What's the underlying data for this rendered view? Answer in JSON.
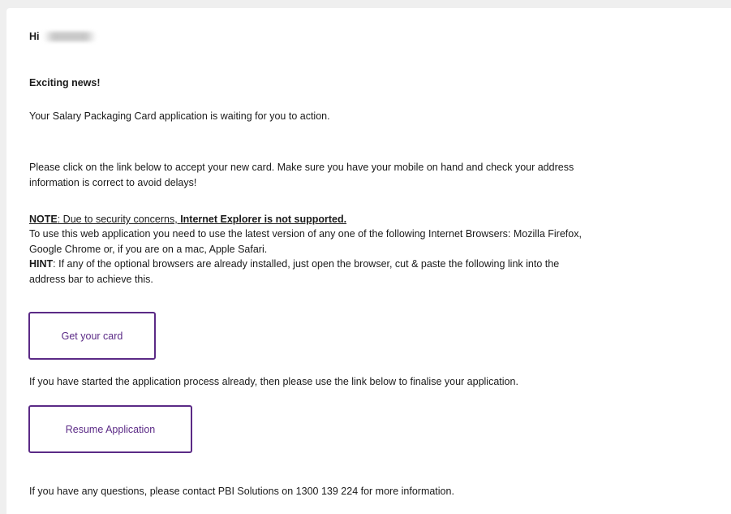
{
  "email": {
    "greeting": "Hi",
    "headline": "Exciting news!",
    "intro": "Your Salary Packaging Card application is waiting for you to action.",
    "instructions": [
      "Please click on the link below to accept your new card. Make sure you have your mobile on hand and check your address",
      "information is correct to avoid delays!"
    ],
    "note": {
      "label": "NOTE",
      "text": ": Due to security concerns, ",
      "emphasis": "Internet Explorer is not supported."
    },
    "browser_requirements": [
      "To use this web application you need to use the latest version of any one of the following Internet Browsers: Mozilla Firefox,",
      "Google Chrome or, if you are on a mac, Apple Safari."
    ],
    "hint": {
      "label": "HINT",
      "lines": [
        ": If any of the optional browsers are already installed, just open the browser, cut & paste the following link into the",
        "address bar to achieve this."
      ]
    },
    "get_card_button": "Get your card",
    "resume_text": "If you have started the application process already, then please use the link below to finalise your application.",
    "resume_button": "Resume Application",
    "contact_text": "If you have any questions, please contact PBI Solutions on 1300 139 224 for more information."
  },
  "colors": {
    "button_border": "#5b2a86",
    "button_text": "#5b2a86",
    "background": "#efefef",
    "card": "#ffffff"
  }
}
